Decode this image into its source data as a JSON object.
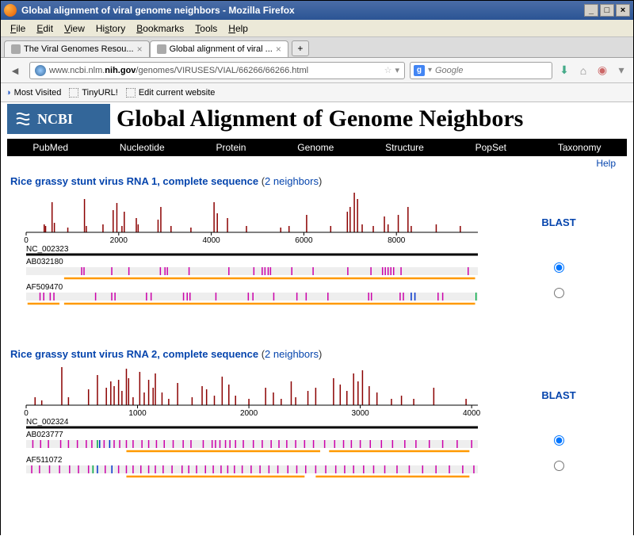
{
  "window": {
    "title": "Global alignment of viral genome neighbors - Mozilla Firefox"
  },
  "menu": {
    "file": "File",
    "edit": "Edit",
    "view": "View",
    "history": "History",
    "bookmarks": "Bookmarks",
    "tools": "Tools",
    "help": "Help"
  },
  "tabs": [
    {
      "label": "The Viral Genomes Resou...",
      "active": false
    },
    {
      "label": "Global alignment of viral ...",
      "active": true
    }
  ],
  "url": {
    "pre": "www.ncbi.nlm.",
    "bold": "nih.gov",
    "post": "/genomes/VIRUSES/VIAL/66266/66266.html"
  },
  "search": {
    "placeholder": "Google"
  },
  "bookmarks": [
    {
      "label": "Most Visited"
    },
    {
      "label": "TinyURL!"
    },
    {
      "label": "Edit current website"
    }
  ],
  "page": {
    "ncbi": "NCBI",
    "title": "Global Alignment of Genome Neighbors",
    "nav": [
      "PubMed",
      "Nucleotide",
      "Protein",
      "Genome",
      "Structure",
      "PopSet",
      "Taxonomy"
    ],
    "help": "Help",
    "blast": "BLAST"
  },
  "alignments": [
    {
      "title": "Rice grassy stunt virus RNA 1, complete sequence",
      "neighbors": "2 neighbors",
      "ref": "NC_002323",
      "ticks": [
        0,
        2000,
        4000,
        6000,
        8000
      ],
      "xmax": 9760,
      "peaks": [
        [
          390,
          10
        ],
        [
          420,
          8
        ],
        [
          560,
          38
        ],
        [
          610,
          12
        ],
        [
          900,
          6
        ],
        [
          1260,
          42
        ],
        [
          1300,
          8
        ],
        [
          1660,
          10
        ],
        [
          1880,
          28
        ],
        [
          1960,
          37
        ],
        [
          2070,
          8
        ],
        [
          2120,
          26
        ],
        [
          2380,
          18
        ],
        [
          2420,
          10
        ],
        [
          2850,
          16
        ],
        [
          2910,
          32
        ],
        [
          3130,
          8
        ],
        [
          3560,
          6
        ],
        [
          4060,
          38
        ],
        [
          4130,
          24
        ],
        [
          4350,
          18
        ],
        [
          4760,
          8
        ],
        [
          5500,
          6
        ],
        [
          5680,
          8
        ],
        [
          6060,
          22
        ],
        [
          6580,
          8
        ],
        [
          6940,
          26
        ],
        [
          7000,
          32
        ],
        [
          7090,
          50
        ],
        [
          7160,
          42
        ],
        [
          7260,
          10
        ],
        [
          7500,
          8
        ],
        [
          7740,
          20
        ],
        [
          7820,
          10
        ],
        [
          8040,
          22
        ],
        [
          8250,
          32
        ],
        [
          8320,
          8
        ],
        [
          8860,
          10
        ],
        [
          9380,
          8
        ]
      ],
      "ref_orange": [
        [
          30,
          720
        ],
        [
          820,
          9700
        ]
      ],
      "neighbors_data": [
        {
          "acc": "AB032180",
          "orange": [
            [
              820,
              9700
            ]
          ],
          "muts": [
            [
              1200,
              "m"
            ],
            [
              1250,
              "m"
            ],
            [
              1850,
              "m"
            ],
            [
              2220,
              "m"
            ],
            [
              2900,
              "m"
            ],
            [
              3000,
              "m"
            ],
            [
              3050,
              "m"
            ],
            [
              3520,
              "m"
            ],
            [
              4380,
              "m"
            ],
            [
              4920,
              "m"
            ],
            [
              5100,
              "m"
            ],
            [
              5160,
              "m"
            ],
            [
              5230,
              "m"
            ],
            [
              5280,
              "m"
            ],
            [
              5740,
              "m"
            ],
            [
              6200,
              "m"
            ],
            [
              6950,
              "m"
            ],
            [
              7450,
              "m"
            ],
            [
              7700,
              "m"
            ],
            [
              7760,
              "m"
            ],
            [
              7820,
              "m"
            ],
            [
              7880,
              "m"
            ],
            [
              7940,
              "m"
            ],
            [
              8100,
              "m"
            ],
            [
              9550,
              "m"
            ]
          ]
        },
        {
          "acc": "AF509470",
          "orange": [
            [
              30,
              720
            ],
            [
              820,
              9700
            ]
          ],
          "muts": [
            [
              300,
              "m"
            ],
            [
              380,
              "m"
            ],
            [
              520,
              "m"
            ],
            [
              600,
              "m"
            ],
            [
              1500,
              "m"
            ],
            [
              1850,
              "m"
            ],
            [
              1920,
              "m"
            ],
            [
              2600,
              "m"
            ],
            [
              2700,
              "m"
            ],
            [
              3400,
              "m"
            ],
            [
              3480,
              "m"
            ],
            [
              3540,
              "m"
            ],
            [
              4100,
              "m"
            ],
            [
              4800,
              "m"
            ],
            [
              4900,
              "m"
            ],
            [
              5350,
              "m"
            ],
            [
              5850,
              "m"
            ],
            [
              6050,
              "m"
            ],
            [
              6520,
              "m"
            ],
            [
              7400,
              "m"
            ],
            [
              7460,
              "m"
            ],
            [
              8080,
              "m"
            ],
            [
              8150,
              "m"
            ],
            [
              8320,
              "b"
            ],
            [
              8400,
              "b"
            ],
            [
              8900,
              "m"
            ],
            [
              9000,
              "m"
            ],
            [
              9720,
              "g"
            ]
          ]
        }
      ]
    },
    {
      "title": "Rice grassy stunt virus RNA 2, complete sequence",
      "neighbors": "2 neighbors",
      "ref": "NC_002324",
      "ticks": [
        0,
        1000,
        2000,
        3000,
        4000
      ],
      "xmax": 4056,
      "peaks": [
        [
          80,
          10
        ],
        [
          140,
          6
        ],
        [
          320,
          48
        ],
        [
          380,
          10
        ],
        [
          560,
          20
        ],
        [
          640,
          38
        ],
        [
          720,
          22
        ],
        [
          760,
          30
        ],
        [
          790,
          24
        ],
        [
          830,
          32
        ],
        [
          860,
          18
        ],
        [
          900,
          46
        ],
        [
          920,
          34
        ],
        [
          960,
          10
        ],
        [
          1020,
          42
        ],
        [
          1060,
          16
        ],
        [
          1100,
          32
        ],
        [
          1140,
          22
        ],
        [
          1160,
          40
        ],
        [
          1220,
          16
        ],
        [
          1280,
          8
        ],
        [
          1360,
          28
        ],
        [
          1490,
          10
        ],
        [
          1580,
          24
        ],
        [
          1620,
          20
        ],
        [
          1690,
          12
        ],
        [
          1760,
          36
        ],
        [
          1820,
          26
        ],
        [
          1880,
          12
        ],
        [
          2000,
          8
        ],
        [
          2150,
          22
        ],
        [
          2220,
          16
        ],
        [
          2290,
          8
        ],
        [
          2380,
          30
        ],
        [
          2420,
          10
        ],
        [
          2530,
          18
        ],
        [
          2600,
          22
        ],
        [
          2760,
          34
        ],
        [
          2820,
          26
        ],
        [
          2880,
          18
        ],
        [
          2940,
          40
        ],
        [
          2980,
          30
        ],
        [
          3020,
          44
        ],
        [
          3080,
          24
        ],
        [
          3150,
          16
        ],
        [
          3280,
          8
        ],
        [
          3370,
          12
        ],
        [
          3480,
          8
        ],
        [
          3660,
          22
        ],
        [
          3950,
          8
        ]
      ],
      "ref_orange": [
        [
          30,
          350
        ],
        [
          450,
          1060
        ]
      ],
      "neighbors_data": [
        {
          "acc": "AB023777",
          "orange": [
            [
              900,
              2640
            ],
            [
              2720,
              3980
            ]
          ],
          "muts": [
            [
              60,
              "m"
            ],
            [
              130,
              "m"
            ],
            [
              200,
              "m"
            ],
            [
              310,
              "m"
            ],
            [
              380,
              "m"
            ],
            [
              460,
              "m"
            ],
            [
              540,
              "m"
            ],
            [
              590,
              "m"
            ],
            [
              640,
              "g"
            ],
            [
              660,
              "b"
            ],
            [
              700,
              "m"
            ],
            [
              750,
              "b"
            ],
            [
              790,
              "m"
            ],
            [
              840,
              "m"
            ],
            [
              900,
              "m"
            ],
            [
              960,
              "m"
            ],
            [
              1040,
              "m"
            ],
            [
              1100,
              "m"
            ],
            [
              1170,
              "m"
            ],
            [
              1240,
              "m"
            ],
            [
              1320,
              "m"
            ],
            [
              1410,
              "m"
            ],
            [
              1480,
              "m"
            ],
            [
              1590,
              "m"
            ],
            [
              1670,
              "m"
            ],
            [
              1700,
              "m"
            ],
            [
              1740,
              "m"
            ],
            [
              1790,
              "m"
            ],
            [
              1830,
              "m"
            ],
            [
              1880,
              "m"
            ],
            [
              1950,
              "m"
            ],
            [
              2040,
              "m"
            ],
            [
              2120,
              "m"
            ],
            [
              2200,
              "m"
            ],
            [
              2270,
              "m"
            ],
            [
              2340,
              "m"
            ],
            [
              2420,
              "m"
            ],
            [
              2500,
              "m"
            ],
            [
              2580,
              "m"
            ],
            [
              2680,
              "m"
            ],
            [
              2770,
              "m"
            ],
            [
              2850,
              "m"
            ],
            [
              2920,
              "m"
            ],
            [
              3000,
              "m"
            ],
            [
              3090,
              "m"
            ],
            [
              3190,
              "m"
            ],
            [
              3290,
              "m"
            ],
            [
              3400,
              "m"
            ],
            [
              3500,
              "m"
            ],
            [
              3620,
              "m"
            ],
            [
              3740,
              "m"
            ],
            [
              3870,
              "m"
            ],
            [
              4000,
              "m"
            ]
          ]
        },
        {
          "acc": "AF511072",
          "orange": [
            [
              900,
              2500
            ],
            [
              2600,
              3980
            ]
          ],
          "muts": [
            [
              50,
              "m"
            ],
            [
              120,
              "m"
            ],
            [
              210,
              "m"
            ],
            [
              300,
              "m"
            ],
            [
              390,
              "m"
            ],
            [
              470,
              "m"
            ],
            [
              560,
              "m"
            ],
            [
              600,
              "g"
            ],
            [
              640,
              "b"
            ],
            [
              710,
              "m"
            ],
            [
              770,
              "b"
            ],
            [
              830,
              "m"
            ],
            [
              900,
              "m"
            ],
            [
              960,
              "m"
            ],
            [
              1030,
              "m"
            ],
            [
              1100,
              "m"
            ],
            [
              1160,
              "m"
            ],
            [
              1230,
              "m"
            ],
            [
              1310,
              "m"
            ],
            [
              1400,
              "m"
            ],
            [
              1460,
              "m"
            ],
            [
              1530,
              "m"
            ],
            [
              1610,
              "m"
            ],
            [
              1680,
              "m"
            ],
            [
              1750,
              "m"
            ],
            [
              1810,
              "m"
            ],
            [
              1870,
              "m"
            ],
            [
              1940,
              "m"
            ],
            [
              2020,
              "m"
            ],
            [
              2100,
              "m"
            ],
            [
              2180,
              "m"
            ],
            [
              2260,
              "m"
            ],
            [
              2350,
              "m"
            ],
            [
              2430,
              "m"
            ],
            [
              2510,
              "m"
            ],
            [
              2600,
              "m"
            ],
            [
              2690,
              "m"
            ],
            [
              2780,
              "m"
            ],
            [
              2860,
              "m"
            ],
            [
              2940,
              "m"
            ],
            [
              3030,
              "m"
            ],
            [
              3120,
              "m"
            ],
            [
              3220,
              "m"
            ],
            [
              3330,
              "m"
            ],
            [
              3440,
              "m"
            ],
            [
              3560,
              "m"
            ],
            [
              3680,
              "m"
            ],
            [
              3800,
              "m"
            ],
            [
              3920,
              "m"
            ],
            [
              4020,
              "m"
            ]
          ]
        }
      ]
    }
  ]
}
